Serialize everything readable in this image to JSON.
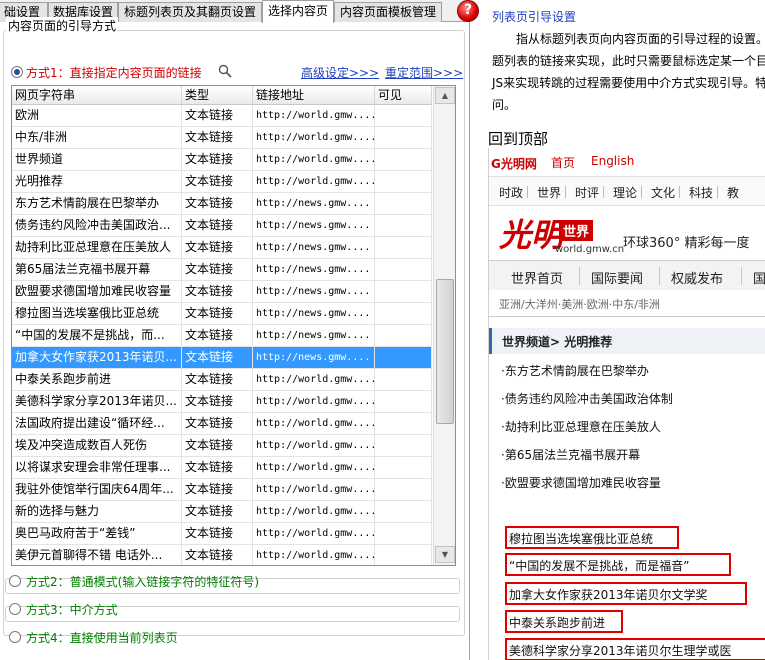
{
  "tabs": [
    {
      "label": "础设置"
    },
    {
      "label": "数据库设置"
    },
    {
      "label": "标题列表页及其翻页设置"
    },
    {
      "label": "选择内容页",
      "active": true
    },
    {
      "label": "内容页面模板管理"
    }
  ],
  "help_button": "?",
  "group_title": "内容页面的引导方式",
  "modes": {
    "mode1": "方式1：直接指定内容页面的链接",
    "mode2": "方式2：普通模式(输入链接字符的特征符号)",
    "mode3": "方式3：中介方式",
    "mode4": "方式4：直接使用当前列表页"
  },
  "links": {
    "advanced": "高级设定>>>",
    "range": "重定范围>>>"
  },
  "table": {
    "columns": [
      "网页字符串",
      "类型",
      "链接地址",
      "可见"
    ],
    "rows": [
      {
        "text": "欧洲",
        "type": "文本链接",
        "url": "http://world.gmw...."
      },
      {
        "text": "中东/非洲",
        "type": "文本链接",
        "url": "http://world.gmw...."
      },
      {
        "text": "世界频道",
        "type": "文本链接",
        "url": "http://world.gmw...."
      },
      {
        "text": "光明推荐",
        "type": "文本链接",
        "url": "http://world.gmw...."
      },
      {
        "text": "东方艺术情韵展在巴黎举办",
        "type": "文本链接",
        "url": "http://news.gmw...."
      },
      {
        "text": "债务违约风险冲击美国政治...",
        "type": "文本链接",
        "url": "http://news.gmw...."
      },
      {
        "text": "劫持利比亚总理意在压美放人",
        "type": "文本链接",
        "url": "http://news.gmw...."
      },
      {
        "text": "第65届法兰克福书展开幕",
        "type": "文本链接",
        "url": "http://news.gmw...."
      },
      {
        "text": "欧盟要求德国增加难民收容量",
        "type": "文本链接",
        "url": "http://news.gmw...."
      },
      {
        "text": "穆拉图当选埃塞俄比亚总统",
        "type": "文本链接",
        "url": "http://news.gmw...."
      },
      {
        "text": "“中国的发展不是挑战，而...",
        "type": "文本链接",
        "url": "http://news.gmw...."
      },
      {
        "text": "加拿大女作家获2013年诺贝...",
        "type": "文本链接",
        "url": "http://news.gmw...."
      },
      {
        "text": "中泰关系跑步前进",
        "type": "文本链接",
        "url": "http://world.gmw...."
      },
      {
        "text": "美德科学家分享2013年诺贝...",
        "type": "文本链接",
        "url": "http://world.gmw...."
      },
      {
        "text": "法国政府提出建设“循环经...",
        "type": "文本链接",
        "url": "http://world.gmw...."
      },
      {
        "text": "埃及冲突造成数百人死伤",
        "type": "文本链接",
        "url": "http://world.gmw...."
      },
      {
        "text": "以将谋求安理会非常任理事...",
        "type": "文本链接",
        "url": "http://world.gmw...."
      },
      {
        "text": "我驻外使馆举行国庆64周年...",
        "type": "文本链接",
        "url": "http://world.gmw...."
      },
      {
        "text": "新的选择与魅力",
        "type": "文本链接",
        "url": "http://world.gmw...."
      },
      {
        "text": "奥巴马政府苦于“差钱”",
        "type": "文本链接",
        "url": "http://world.gmw...."
      },
      {
        "text": "美伊元首聊得不错 电话外...",
        "type": "文本链接",
        "url": "http://world.gmw...."
      }
    ],
    "selected_index": 11
  },
  "help": {
    "title": "列表页引导设置",
    "lines": [
      "指从标题列表页向内容页面的引导过程的设置。",
      "题列表的链接来实现，此时只需要鼠标选定某一个目",
      "JS来实现转跳的过程需要使用中介方式实现引导。特",
      "问。"
    ]
  },
  "preview": {
    "back_to_top": "回到顶部",
    "logo": "G光明网",
    "nav_home": "首页",
    "nav_english": "English",
    "topnav": [
      "时政",
      "世界",
      "时评",
      "理论",
      "文化",
      "科技",
      "教"
    ],
    "brand": "光明",
    "brand_badge": "世界",
    "brand_url": "world.gmw.cn",
    "slogan": "环球360° 精彩每一度",
    "secnav": [
      "世界首页",
      "国际要闻",
      "权威发布",
      "国"
    ],
    "regions": "亚洲/大洋州·美洲·欧洲·中东/非洲",
    "crumb": "世界频道> 光明推荐",
    "articles": [
      "·东方艺术情韵展在巴黎举办",
      "·债务违约风险冲击美国政治体制",
      "·劫持利比亚总理意在压美放人",
      "·第65届法兰克福书展开幕",
      "·欧盟要求德国增加难民收容量"
    ],
    "highlighted": [
      "穆拉图当选埃塞俄比亚总统",
      "“中国的发展不是挑战，而是福音”",
      "加拿大女作家获2013年诺贝尔文学奖",
      "中泰关系跑步前进",
      "美德科学家分享2013年诺贝尔生理学或医"
    ]
  }
}
